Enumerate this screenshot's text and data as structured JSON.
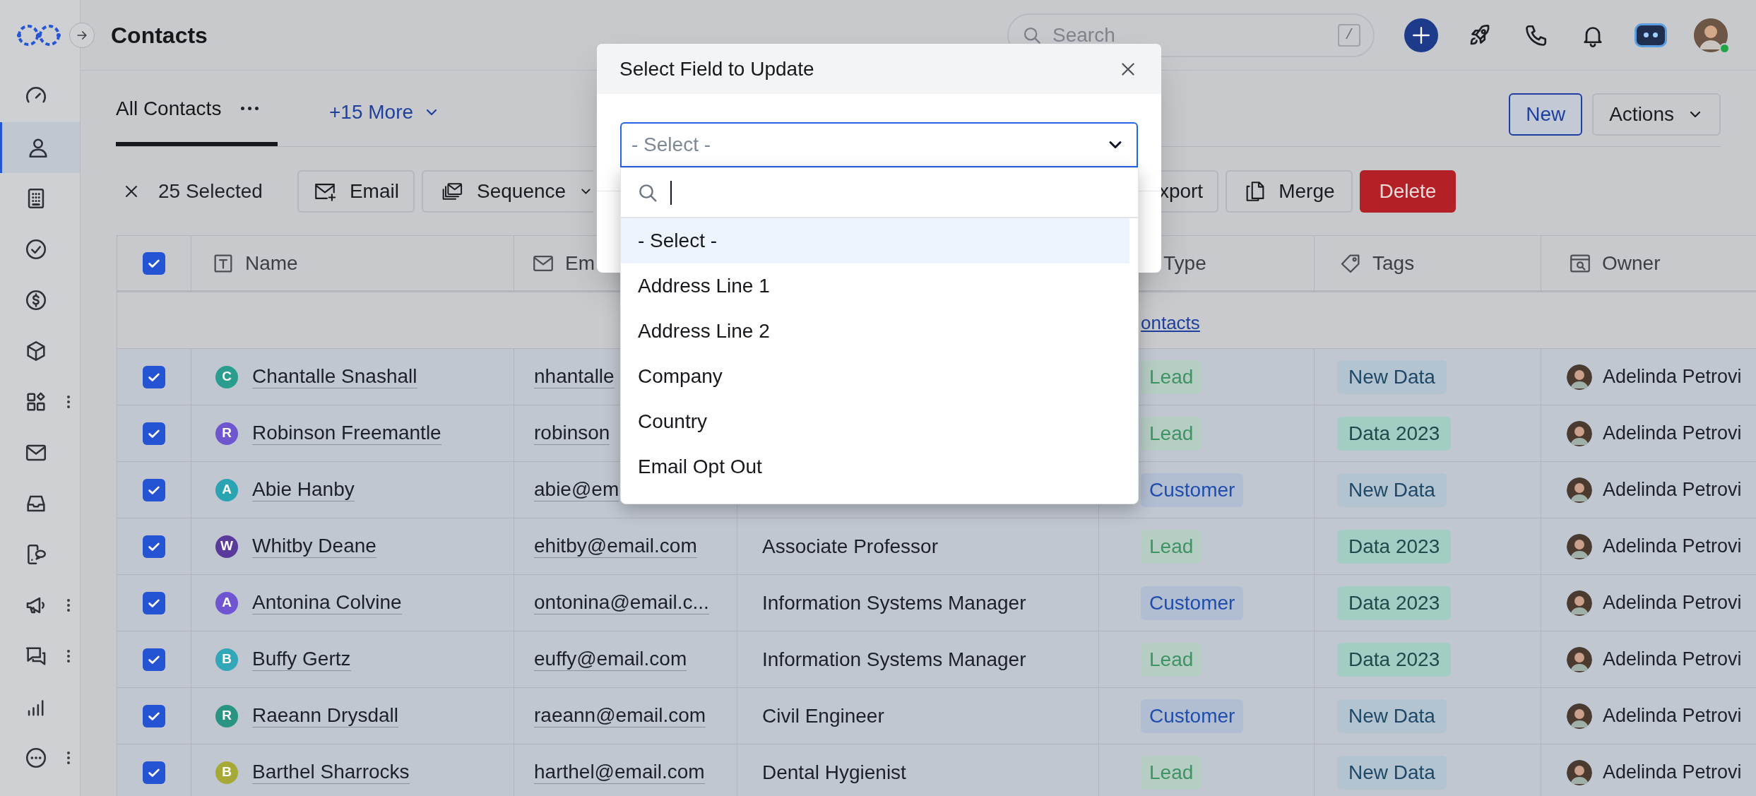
{
  "sidebar": {
    "items": [
      {
        "kind": "gauge",
        "selected": false,
        "more": false
      },
      {
        "kind": "person",
        "selected": true,
        "more": false
      },
      {
        "kind": "building",
        "selected": false,
        "more": false
      },
      {
        "kind": "check",
        "selected": false,
        "more": false
      },
      {
        "kind": "dollar",
        "selected": false,
        "more": false
      },
      {
        "kind": "cube",
        "selected": false,
        "more": false
      },
      {
        "kind": "apps",
        "selected": false,
        "more": true
      },
      {
        "kind": "mail",
        "selected": false,
        "more": false
      },
      {
        "kind": "inbox",
        "selected": false,
        "more": false
      },
      {
        "kind": "phone-chat",
        "selected": false,
        "more": false
      },
      {
        "kind": "megaphone",
        "selected": false,
        "more": true
      },
      {
        "kind": "chats",
        "selected": false,
        "more": true
      },
      {
        "kind": "bars",
        "selected": false,
        "more": false
      },
      {
        "kind": "more",
        "selected": false,
        "more": true
      }
    ]
  },
  "header": {
    "title": "Contacts",
    "search": {
      "placeholder": "Search",
      "shortcut": "/"
    }
  },
  "tabs": [
    {
      "label": "All Contacts",
      "selected": true,
      "menu": true
    }
  ],
  "more_views": "+15 More",
  "header_buttons": [
    {
      "label": "New",
      "kind": "outline"
    },
    {
      "label": "Actions",
      "kind": "menu"
    }
  ],
  "selection": {
    "label": "25 Selected"
  },
  "bulk_actions": [
    {
      "label": "Email",
      "kind": "email"
    },
    {
      "label": "Sequence",
      "kind": "sequence"
    },
    {
      "label": "xport",
      "kind": "cut"
    },
    {
      "label": "Merge",
      "kind": "merge"
    },
    {
      "label": "Delete",
      "kind": "danger"
    }
  ],
  "table": {
    "all_selected": true,
    "columns": [
      {
        "label": "Name",
        "kind": "name"
      },
      {
        "label": "Em",
        "kind": "email"
      },
      {
        "label": "Type",
        "kind": "type"
      },
      {
        "label": "Tags",
        "kind": "tags"
      },
      {
        "label": "Owner",
        "kind": "owner"
      }
    ],
    "band_link": "ontacts",
    "rows": [
      {
        "selected": true,
        "initial": "C",
        "color": "#2a9d8f",
        "name": "Chantalle Snashall",
        "email": "nhantalle",
        "type": {
          "label": "Lead",
          "kind": "lead"
        },
        "tag": {
          "label": "New Data",
          "kind": "new"
        },
        "owner": "Adelinda Petrovi"
      },
      {
        "selected": true,
        "initial": "R",
        "color": "#6e56cf",
        "name": "Robinson Freemantle",
        "email": "robinson",
        "type": {
          "label": "Lead",
          "kind": "lead"
        },
        "tag": {
          "label": "Data 2023",
          "kind": "year"
        },
        "owner": "Adelinda Petrovi"
      },
      {
        "selected": true,
        "initial": "A",
        "color": "#2aa3b3",
        "name": "Abie Hanby",
        "email": "abie@em",
        "type": {
          "label": "Customer",
          "kind": "customer"
        },
        "tag": {
          "label": "New Data",
          "kind": "new"
        },
        "owner": "Adelinda Petrovi"
      },
      {
        "selected": true,
        "initial": "W",
        "color": "#5a3a9a",
        "name": "Whitby Deane",
        "email": "ehitby@email.com",
        "title": "Associate Professor",
        "type": {
          "label": "Lead",
          "kind": "lead"
        },
        "tag": {
          "label": "Data 2023",
          "kind": "year"
        },
        "owner": "Adelinda Petrovi"
      },
      {
        "selected": true,
        "initial": "A",
        "color": "#6f55d2",
        "name": "Antonina Colvine",
        "email": "ontonina@email.c...",
        "title": "Information Systems Manager",
        "type": {
          "label": "Customer",
          "kind": "customer"
        },
        "tag": {
          "label": "Data 2023",
          "kind": "year"
        },
        "owner": "Adelinda Petrovi"
      },
      {
        "selected": true,
        "initial": "B",
        "color": "#31a7b8",
        "name": "Buffy Gertz",
        "email": "euffy@email.com",
        "title": "Information Systems Manager",
        "type": {
          "label": "Lead",
          "kind": "lead"
        },
        "tag": {
          "label": "Data 2023",
          "kind": "year"
        },
        "owner": "Adelinda Petrovi"
      },
      {
        "selected": true,
        "initial": "R",
        "color": "#2a9483",
        "name": "Raeann Drysdall",
        "email": "raeann@email.com",
        "title": "Civil Engineer",
        "type": {
          "label": "Customer",
          "kind": "customer"
        },
        "tag": {
          "label": "New Data",
          "kind": "new"
        },
        "owner": "Adelinda Petrovi"
      },
      {
        "selected": true,
        "initial": "B",
        "color": "#a7a936",
        "name": "Barthel Sharrocks",
        "email": "harthel@email.com",
        "title": "Dental Hygienist",
        "type": {
          "label": "Lead",
          "kind": "lead"
        },
        "tag": {
          "label": "New Data",
          "kind": "new"
        },
        "owner": "Adelinda Petrovi"
      }
    ]
  },
  "modal": {
    "title": "Select Field to Update",
    "field": {
      "placeholder": "- Select -",
      "expanded": true
    },
    "options": [
      {
        "label": "- Select -",
        "selected": true
      },
      {
        "label": "Address Line 1",
        "selected": false
      },
      {
        "label": "Address Line 2",
        "selected": false
      },
      {
        "label": "Company",
        "selected": false
      },
      {
        "label": "Country",
        "selected": false
      },
      {
        "label": "Email Opt Out",
        "selected": false
      }
    ]
  }
}
